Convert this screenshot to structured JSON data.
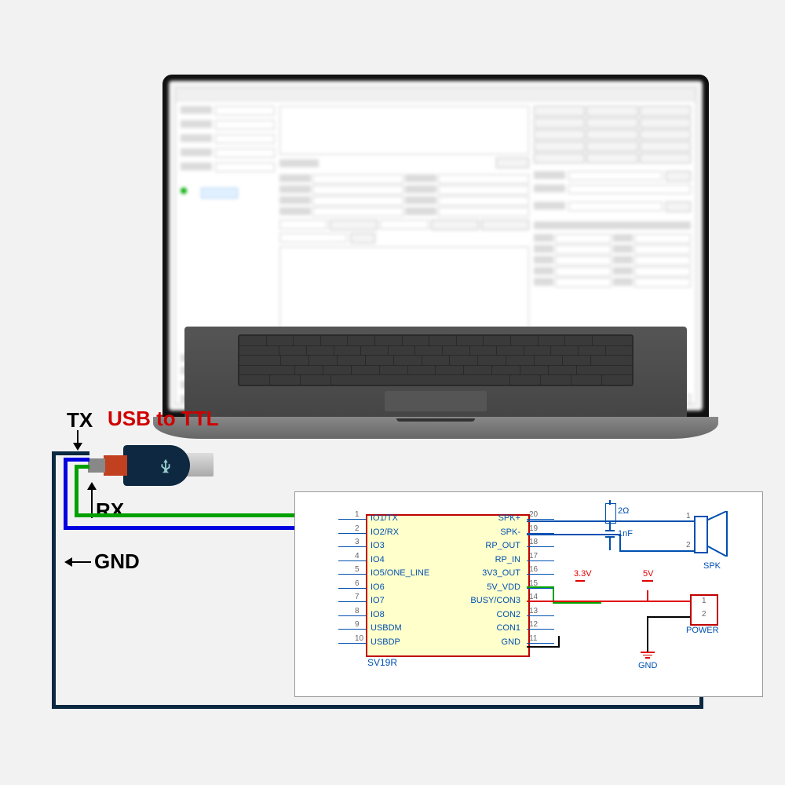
{
  "labels": {
    "tx": "TX",
    "rx": "RX",
    "gnd": "GND",
    "usb_to_ttl": "USB to TTL"
  },
  "colors": {
    "tx_wire": "#0000e0",
    "rx_wire": "#00a000",
    "gnd_wire": "#0a2840",
    "vcc_5v": "#e00000",
    "vcc_3v3": "#00a000",
    "label_red": "#d00000"
  },
  "schematic": {
    "chip_name": "SV19R",
    "left_pins": [
      {
        "num": "1",
        "name": "IO1/TX"
      },
      {
        "num": "2",
        "name": "IO2/RX"
      },
      {
        "num": "3",
        "name": "IO3"
      },
      {
        "num": "4",
        "name": "IO4"
      },
      {
        "num": "5",
        "name": "IO5/ONE_LINE"
      },
      {
        "num": "6",
        "name": "IO6"
      },
      {
        "num": "7",
        "name": "IO7"
      },
      {
        "num": "8",
        "name": "IO8"
      },
      {
        "num": "9",
        "name": "USBDM"
      },
      {
        "num": "10",
        "name": "USBDP"
      }
    ],
    "right_pins": [
      {
        "num": "20",
        "name": "SPK+"
      },
      {
        "num": "19",
        "name": "SPK-"
      },
      {
        "num": "18",
        "name": "RP_OUT"
      },
      {
        "num": "17",
        "name": "RP_IN"
      },
      {
        "num": "16",
        "name": "3V3_OUT"
      },
      {
        "num": "15",
        "name": "5V_VDD"
      },
      {
        "num": "14",
        "name": "BUSY/CON3"
      },
      {
        "num": "13",
        "name": "CON2"
      },
      {
        "num": "12",
        "name": "CON1"
      },
      {
        "num": "11",
        "name": "GND"
      }
    ],
    "components": {
      "resistor": "2Ω",
      "capacitor": "1nF",
      "speaker": "SPK",
      "power": "POWER",
      "power_pins": [
        "1",
        "2"
      ],
      "gnd": "GND",
      "v33": "3.3V",
      "v5": "5V"
    }
  }
}
